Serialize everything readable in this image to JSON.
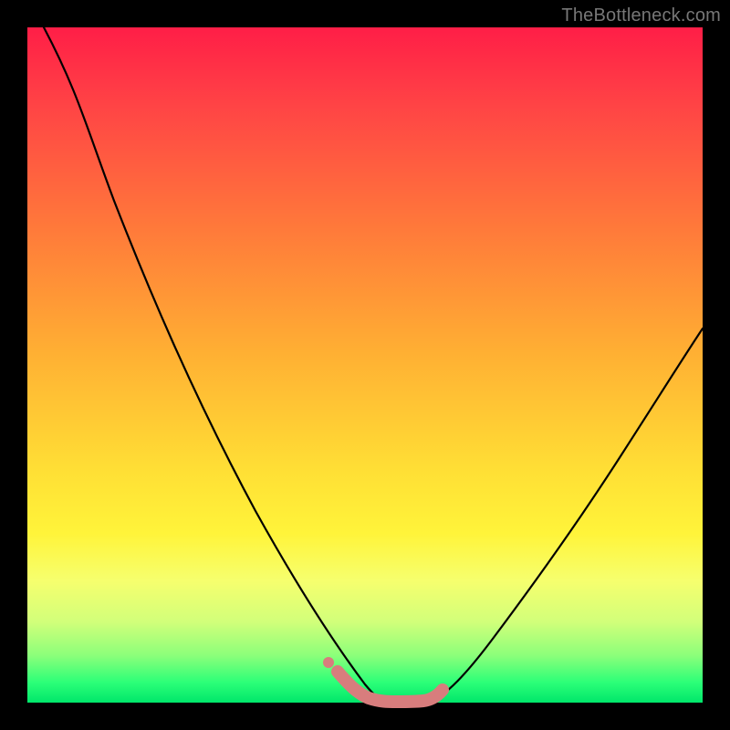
{
  "watermark": {
    "text": "TheBottleneck.com"
  },
  "colors": {
    "gradient_top": "#ff1e47",
    "gradient_mid": "#ffe035",
    "gradient_bottom": "#00e66a",
    "curve_stroke": "#000000",
    "highlight_stroke": "#d87d7d"
  },
  "chart_data": {
    "type": "line",
    "title": "",
    "xlabel": "",
    "ylabel": "",
    "xlim": [
      0,
      100
    ],
    "ylim": [
      0,
      100
    ],
    "grid": false,
    "legend": false,
    "series": [
      {
        "name": "left-curve",
        "x": [
          2,
          5,
          8,
          12,
          18,
          24,
          30,
          36,
          42,
          46,
          49,
          51,
          52
        ],
        "values": [
          100,
          88,
          77,
          67,
          55,
          44,
          33,
          22,
          12,
          6,
          2,
          0.5,
          0
        ]
      },
      {
        "name": "right-curve",
        "x": [
          60,
          62,
          65,
          70,
          76,
          82,
          88,
          94,
          100
        ],
        "values": [
          0,
          1,
          3,
          8,
          16,
          25,
          35,
          45,
          55
        ]
      },
      {
        "name": "highlight-segment",
        "x": [
          46,
          49,
          51,
          53,
          56,
          59,
          61
        ],
        "values": [
          4,
          1,
          0,
          0,
          0,
          0.5,
          1.5
        ]
      }
    ],
    "note": "Values estimated from pixel positions. y is percent of plot height from bottom; x is percent of plot width from left."
  }
}
